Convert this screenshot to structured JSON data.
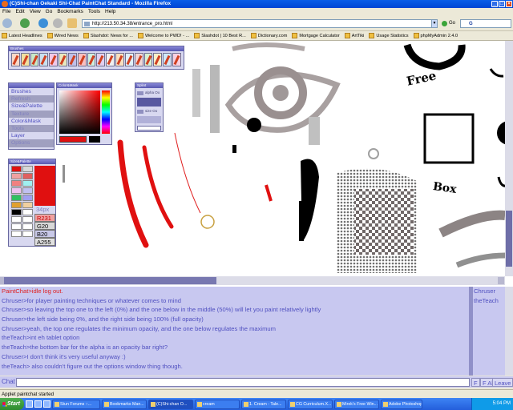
{
  "window": {
    "title": "(C)Shi-chan Oekaki Shi-Chat PaintChat Standard - Mozilla Firefox"
  },
  "menu": [
    "File",
    "Edit",
    "View",
    "Go",
    "Bookmarks",
    "Tools",
    "Help"
  ],
  "nav": {
    "url": "http://213.50.34.38/entrance_pro.html",
    "go_label": "Go",
    "search_brand": "G"
  },
  "bookmarks": [
    "Latest Headlines",
    "Wired News",
    "Slashdot: News for ...",
    "Welcome to PWD! - ...",
    "Slashdot | 10 Best R...",
    "Dictionary.com",
    "Mortgage Calculator",
    "ArtTiki",
    "Usage Statistics",
    "phpMyAdmin 2.4.0"
  ],
  "panels": {
    "brushes_title": "Brushes",
    "color_title": "Color&Mask",
    "alpha_title": "Splint",
    "alpha_labels": [
      "alpha Oo",
      "size Oo"
    ],
    "size_title": "Size&Palette",
    "tools": [
      "Brushes",
      "Refresh",
      "Size&Palette",
      "Texture",
      "Color&Mask",
      "Tools",
      "Layer",
      "Options"
    ],
    "size_values": {
      "px": "34px",
      "r": "R231",
      "g": "G20",
      "b": "B20",
      "a": "A255"
    }
  },
  "colors": {
    "palette": [
      "#e01010",
      "#d8d8d8",
      "#f0a0a0",
      "#e06060",
      "#f08080",
      "#a0f0f0",
      "#f0c0f0",
      "#c0c0f0",
      "#30c060",
      "#a0a0f0",
      "#e0a030",
      "#f0d0a0",
      "#000000",
      "#ffffff",
      "#ffffff",
      "#ffffff",
      "#ffffff",
      "#ffffff",
      "#ffffff",
      "#ffffff"
    ],
    "current": "#e01010",
    "accent": "#5050c0"
  },
  "canvas_text": [
    "Free",
    "Box"
  ],
  "chat": {
    "lines": [
      "PaintChat>idle log out.",
      "Chruser>for player painting techniques or whatever comes to mind",
      "Chruser>so leaving the top one to the left (0%) and the one below in the middle (50%) will let you paint relatively lightly",
      "Chruser>the left side being 0%, and the right side being 100% (full opacity)",
      "Chruser>yeah, the top one regulates the minimum opacity, and the one below regulates the maximum",
      "theTeach>int eh tablet option",
      "theTeach>the bottom bar for the alpha is an opacity bar right?",
      "Chruser>I don't think it's very useful anyway :)",
      "theTeach> also couldn't figure out the options window thing though."
    ],
    "users": [
      "Chruser",
      "theTeach"
    ],
    "label": "Chat",
    "buttons": [
      "F",
      "F All",
      "Leave"
    ]
  },
  "status": "Applet paintchat started",
  "taskbar": {
    "start": "Start",
    "tasks": [
      "Stun Forums ::...",
      "Bookmarks Man...",
      "(C)Shi-chan O...",
      "cream",
      "1. Cream - Tale...",
      "CG Curriculum.X...",
      "Mirek's Free Win...",
      "Adobe Photoshop"
    ],
    "clock": "5:04 PM"
  }
}
